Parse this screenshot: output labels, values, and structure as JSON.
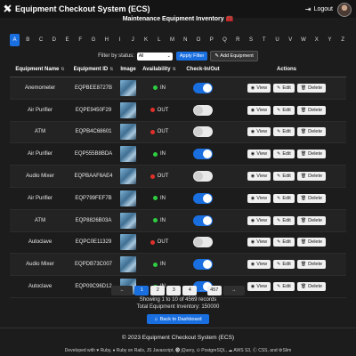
{
  "header": {
    "app_title": "Equipment Checkout System (ECS)",
    "logout_label": "Logout"
  },
  "page_title": "Maintenance Equipment Inventory 🧰",
  "alphabet": [
    "A",
    "B",
    "C",
    "D",
    "E",
    "F",
    "G",
    "H",
    "I",
    "J",
    "K",
    "L",
    "M",
    "N",
    "O",
    "P",
    "Q",
    "R",
    "S",
    "T",
    "U",
    "V",
    "W",
    "X",
    "Y",
    "Z"
  ],
  "alphabet_active": "A",
  "filter": {
    "label": "Filter by status:",
    "selected": "All",
    "apply_label": "Apply Filter",
    "add_label": "Add Equipment"
  },
  "table": {
    "headers": {
      "name": "Equipment Name",
      "id": "Equipment ID",
      "image": "Image",
      "availability": "Availability",
      "checkinout": "Check-In/Out",
      "actions": "Actions"
    },
    "rows": [
      {
        "name": "Anemometer",
        "id": "EQPBEE8727B",
        "status": "IN",
        "checked": true
      },
      {
        "name": "Air Purifier",
        "id": "EQPE9450F29",
        "status": "OUT",
        "checked": false
      },
      {
        "name": "ATM",
        "id": "EQPB4C68601",
        "status": "OUT",
        "checked": false
      },
      {
        "name": "Air Purifier",
        "id": "EQP555B8BDA",
        "status": "IN",
        "checked": true
      },
      {
        "name": "Audio Mixer",
        "id": "EQPBAAF6AE4",
        "status": "OUT",
        "checked": false
      },
      {
        "name": "Air Purifier",
        "id": "EQP799FEF7B",
        "status": "IN",
        "checked": true
      },
      {
        "name": "ATM",
        "id": "EQP8826B03A",
        "status": "IN",
        "checked": true
      },
      {
        "name": "Autoclave",
        "id": "EQPC0E11329",
        "status": "OUT",
        "checked": false
      },
      {
        "name": "Audio Mixer",
        "id": "EQPDB73C007",
        "status": "IN",
        "checked": true
      },
      {
        "name": "Autoclave",
        "id": "EQP09C96D12",
        "status": "IN",
        "checked": true
      }
    ],
    "actions": {
      "view": "View",
      "edit": "Edit",
      "delete": "Delete"
    }
  },
  "pagination": {
    "pages": [
      "1",
      "2",
      "3",
      "4"
    ],
    "ellipsis": "…",
    "last": "457",
    "current": "1"
  },
  "summary": {
    "showing": "Showing 1 to 10 of 4569 records",
    "total": "Total Equipment Inventory: 150000"
  },
  "back_label": "Back to Dashboard",
  "footer": {
    "copyright": "© 2023 Equipment Checkout System (ECS)",
    "developed": "Developed with ♥ Ruby, ♦ Ruby on Rails, JS Javascript, ⓿ jQuery, ⊙ PostgreSQL, ☁ AWS S3, Ⓒ CSS, and ⚙Slim"
  },
  "colors": {
    "accent": "#1a6fe0",
    "in": "#2ecc40",
    "out": "#e0302a"
  }
}
